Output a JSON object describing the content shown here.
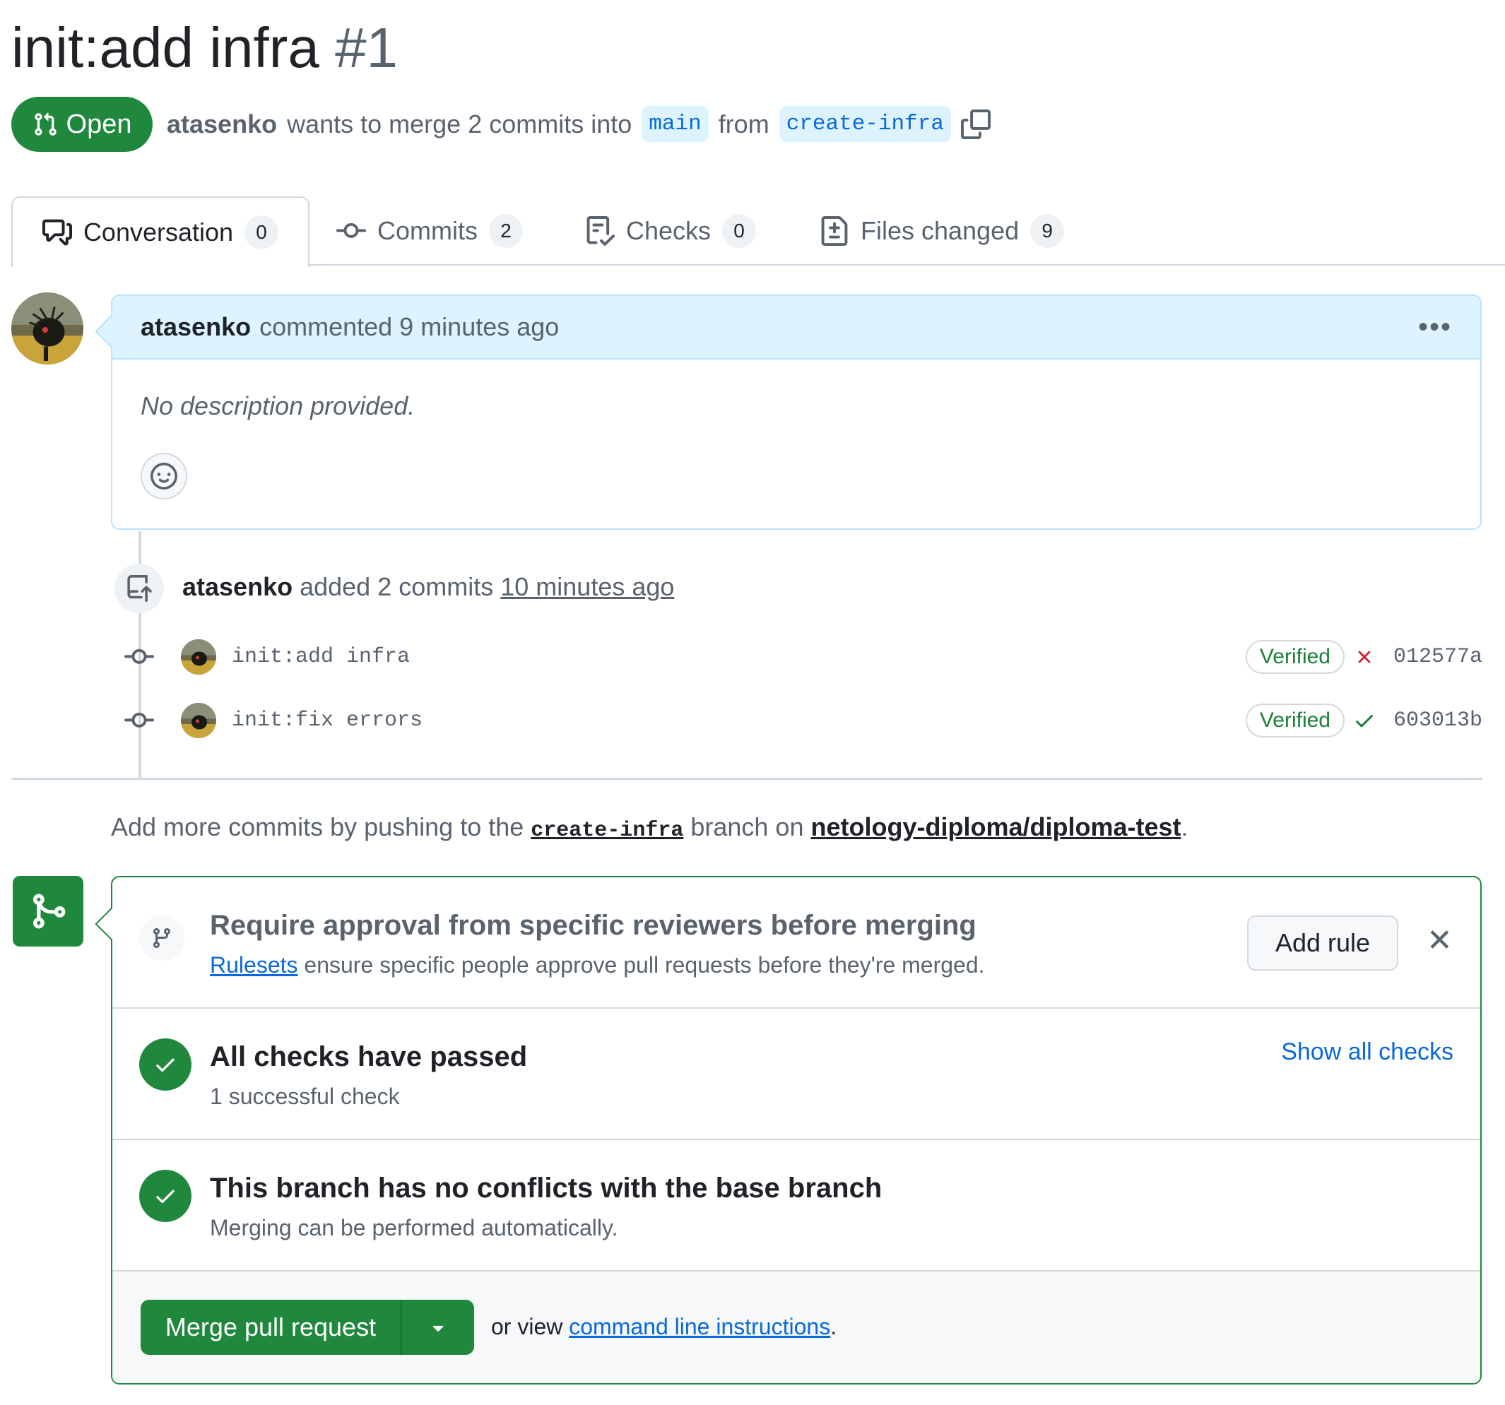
{
  "pr": {
    "title": "init:add infra",
    "number": "#1",
    "state": "Open",
    "author": "atasenko",
    "meta_text": "wants to merge 2 commits into",
    "base_branch": "main",
    "from_text": "from",
    "head_branch": "create-infra"
  },
  "tabs": [
    {
      "label": "Conversation",
      "count": "0"
    },
    {
      "label": "Commits",
      "count": "2"
    },
    {
      "label": "Checks",
      "count": "0"
    },
    {
      "label": "Files changed",
      "count": "9"
    }
  ],
  "comment": {
    "author": "atasenko",
    "action": "commented 9 minutes ago",
    "body": "No description provided."
  },
  "push_event": {
    "author": "atasenko",
    "action": "added 2 commits",
    "time": "10 minutes ago"
  },
  "commits": [
    {
      "message": "init:add infra",
      "badge": "Verified",
      "status": "failed",
      "sha": "012577a"
    },
    {
      "message": "init:fix errors",
      "badge": "Verified",
      "status": "success",
      "sha": "603013b"
    }
  ],
  "push_hint": {
    "prefix": "Add more commits by pushing to the",
    "branch": "create-infra",
    "middle": "branch on",
    "repo": "netology-diploma/diploma-test",
    "suffix": "."
  },
  "merge_box": {
    "rule": {
      "title": "Require approval from specific reviewers before merging",
      "link": "Rulesets",
      "text": "ensure specific people approve pull requests before they're merged.",
      "button": "Add rule"
    },
    "checks": {
      "title": "All checks have passed",
      "subtitle": "1 successful check",
      "link": "Show all checks"
    },
    "conflicts": {
      "title": "This branch has no conflicts with the base branch",
      "subtitle": "Merging can be performed automatically."
    },
    "merge_button": "Merge pull request",
    "or_view": "or view",
    "cli_link": "command line instructions",
    "cli_suffix": "."
  },
  "colors": {
    "success": "#1f883d",
    "link": "#0969da",
    "danger": "#cf222e",
    "muted": "#59636e"
  }
}
